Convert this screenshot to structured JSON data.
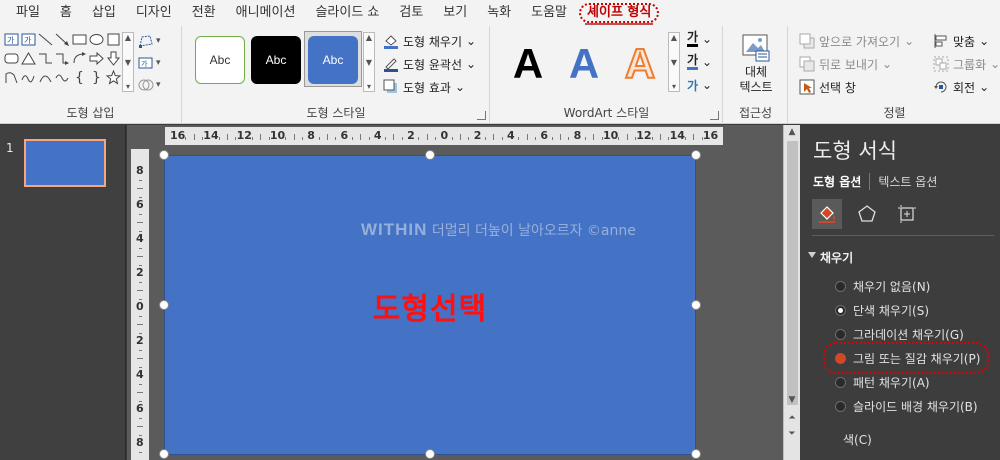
{
  "tabs": [
    "파일",
    "홈",
    "삽입",
    "디자인",
    "전환",
    "애니메이션",
    "슬라이드 쇼",
    "검토",
    "보기",
    "녹화",
    "도움말",
    "셰이프 형식"
  ],
  "active_tab_index": 11,
  "ribbon": {
    "insert_shapes": {
      "label": "도형 삽입"
    },
    "shape_styles": {
      "label": "도형 스타일",
      "presets": [
        "Abc",
        "Abc",
        "Abc"
      ],
      "fill": "도형 채우기",
      "outline": "도형 윤곽선",
      "effects": "도형 효과"
    },
    "wordart": {
      "label": "WordArt 스타일",
      "presets": [
        "A",
        "A",
        "A"
      ],
      "text_fill_glyph": "가",
      "text_outline_glyph": "가",
      "text_effect_glyph": "가"
    },
    "accessibility": {
      "label": "접근성",
      "alt_text_line1": "대체",
      "alt_text_line2": "텍스트"
    },
    "arrange": {
      "label": "정렬",
      "bring_forward": "앞으로 가져오기",
      "send_backward": "뒤로 보내기",
      "selection_pane": "선택 창",
      "align": "맞춤",
      "group": "그룹화",
      "rotate": "회전"
    }
  },
  "slides_panel": {
    "slide_number": "1"
  },
  "ruler": {
    "horizontal_ticks": [
      "16",
      "14",
      "12",
      "10",
      "8",
      "6",
      "4",
      "2",
      "0",
      "2",
      "4",
      "6",
      "8",
      "10",
      "12",
      "14",
      "16"
    ],
    "vertical_ticks": [
      "8",
      "6",
      "4",
      "2",
      "0",
      "2",
      "4",
      "6",
      "8"
    ]
  },
  "slide": {
    "caption": "도형선택",
    "watermark_brand": "WITHIN",
    "watermark_text": "더멀리 더높이 날아오르자 ©anne"
  },
  "format_pane": {
    "title": "도형 서식",
    "tab_shape": "도형 옵션",
    "tab_text": "텍스트 옵션",
    "section": "채우기",
    "options": [
      {
        "label": "채우기 없음(N)",
        "state": "off"
      },
      {
        "label": "단색 채우기(S)",
        "state": "checked"
      },
      {
        "label": "그라데이션 채우기(G)",
        "state": "off"
      },
      {
        "label": "그림 또는 질감 채우기(P)",
        "state": "hot"
      },
      {
        "label": "패턴 채우기(A)",
        "state": "off"
      },
      {
        "label": "슬라이드 배경 채우기(B)",
        "state": "off"
      }
    ],
    "color_label": "색(C)"
  },
  "colors": {
    "shape_blue": "#4472c4",
    "highlight_red": "#e00000",
    "fill_orange": "#d24726"
  }
}
